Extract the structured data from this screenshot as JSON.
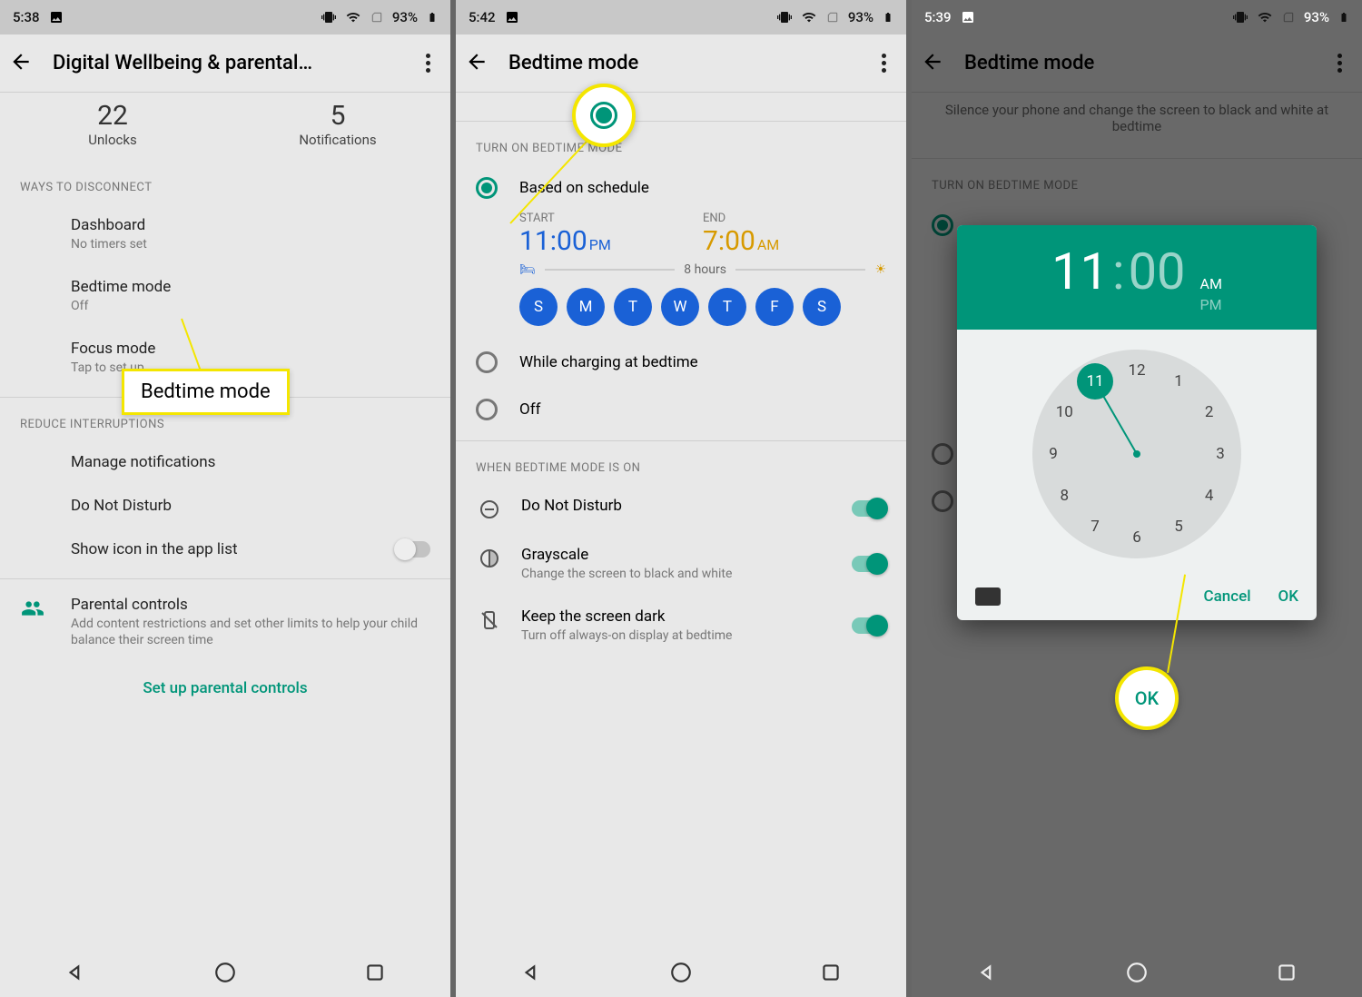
{
  "statusbar": {
    "times": {
      "p1": "5:38",
      "p2": "5:42",
      "p3": "5:39"
    },
    "battery": "93%"
  },
  "phone1": {
    "title": "Digital Wellbeing & parental…",
    "stats": {
      "unlocks_num": "22",
      "unlocks_lbl": "Unlocks",
      "notif_num": "5",
      "notif_lbl": "Notifications"
    },
    "ways_header": "WAYS TO DISCONNECT",
    "dashboard": {
      "t": "Dashboard",
      "s": "No timers set"
    },
    "bedtime": {
      "t": "Bedtime mode",
      "s": "Off"
    },
    "focus": {
      "t": "Focus mode",
      "s": "Tap to set up"
    },
    "reduce_header": "REDUCE INTERRUPTIONS",
    "manage_notif": "Manage notifications",
    "dnd": "Do Not Disturb",
    "show_icon": "Show icon in the app list",
    "parental": {
      "t": "Parental controls",
      "s": "Add content restrictions and set other limits to help your child balance their screen time"
    },
    "setup_link": "Set up parental controls",
    "callout_text": "Bedtime mode"
  },
  "phone2": {
    "title": "Bedtime mode",
    "turnon_header": "TURN ON BEDTIME MODE",
    "opt_schedule": "Based on schedule",
    "start_lbl": "START",
    "end_lbl": "END",
    "start_time": "11:00",
    "start_ampm": "PM",
    "end_time": "7:00",
    "end_ampm": "AM",
    "duration": "8 hours",
    "days": [
      "S",
      "M",
      "T",
      "W",
      "T",
      "F",
      "S"
    ],
    "opt_charging": "While charging at bedtime",
    "opt_off": "Off",
    "when_header": "WHEN BEDTIME MODE IS ON",
    "dnd": "Do Not Disturb",
    "gray": {
      "t": "Grayscale",
      "s": "Change the screen to black and white"
    },
    "dark": {
      "t": "Keep the screen dark",
      "s": "Turn off always-on display at bedtime"
    }
  },
  "phone3": {
    "title": "Bedtime mode",
    "desc": "Silence your phone and change the screen to black and white at bedtime",
    "turnon_header": "TURN ON BEDTIME MODE",
    "picker": {
      "hour": "11",
      "min": "00",
      "am": "AM",
      "pm": "PM",
      "cancel": "Cancel",
      "ok": "OK"
    },
    "callout_ok": "OK"
  }
}
